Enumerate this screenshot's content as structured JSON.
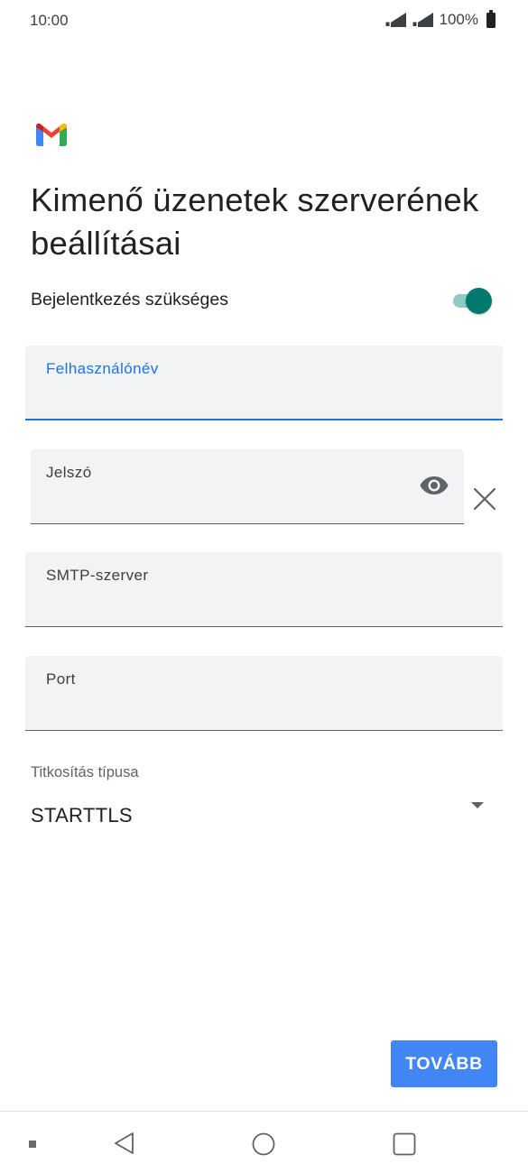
{
  "status_bar": {
    "time": "10:00",
    "battery_percent": "100%",
    "icons": [
      "sim1-signal-icon",
      "sim2-signal-icon",
      "battery-icon"
    ]
  },
  "app": {
    "logo": "gmail-logo",
    "colors": {
      "red": "#ea4335",
      "blue": "#4285f4",
      "green": "#34a853",
      "yellow": "#fbbc04",
      "dark_red": "#c5221f"
    }
  },
  "title": "Kimenő üzenetek szerverének beállításai",
  "login_required": {
    "label": "Bejelentkezés szükséges",
    "enabled": true,
    "colors": {
      "thumb": "#01796f",
      "track": "#8fcbc3"
    }
  },
  "fields": {
    "username": {
      "label": "Felhasználónév",
      "value": "",
      "focused": true
    },
    "password": {
      "label": "Jelszó",
      "value": "",
      "icons": [
        "eye-icon",
        "close-icon"
      ]
    },
    "smtp_server": {
      "label": "SMTP-szerver",
      "value": ""
    },
    "port": {
      "label": "Port",
      "value": ""
    }
  },
  "encryption": {
    "label": "Titkosítás típusa",
    "selected": "STARTTLS",
    "icon": "dropdown-arrow-icon"
  },
  "next_button": {
    "label": "TOVÁBB",
    "color": "#4285f4"
  },
  "nav_bar": {
    "icons": [
      "nav-dot-icon",
      "back-icon",
      "home-icon",
      "recents-icon"
    ]
  },
  "accent_color": "#1a73e8"
}
